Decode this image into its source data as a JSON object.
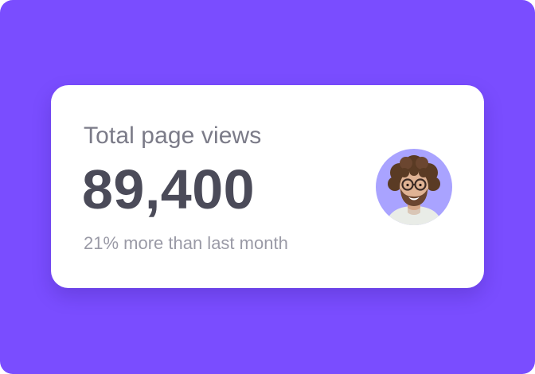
{
  "card": {
    "label": "Total page views",
    "value": "89,400",
    "caption": "21% more than last month"
  },
  "colors": {
    "background": "#7a4dff",
    "card": "#ffffff",
    "value_text": "#4b4b59",
    "label_text": "#7b7b88",
    "caption_text": "#9a9aa6",
    "avatar_bg": "#a9a3ff"
  },
  "avatar": {
    "icon": "user-avatar-photo"
  }
}
